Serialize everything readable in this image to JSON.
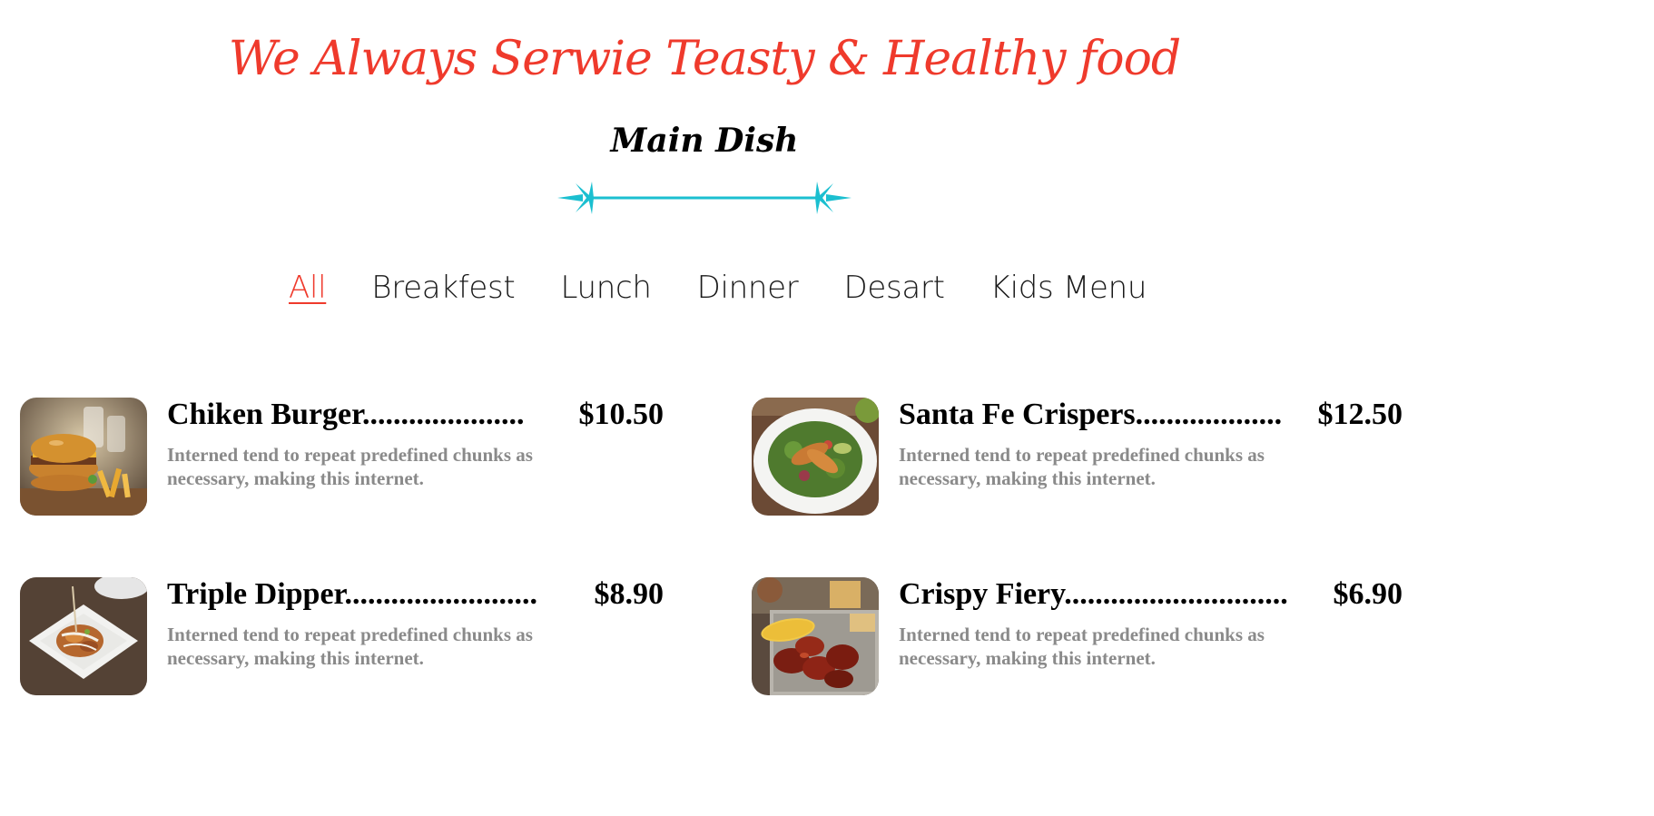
{
  "header": {
    "tagline": "We Always Serwie Teasty & Healthy food",
    "section_title": "Main Dish",
    "accent_color": "#ef3a2c",
    "divider_color": "#1bbfd0"
  },
  "tabs": [
    {
      "label": "All",
      "active": true
    },
    {
      "label": "Breakfest",
      "active": false
    },
    {
      "label": "Lunch",
      "active": false
    },
    {
      "label": "Dinner",
      "active": false
    },
    {
      "label": "Desart",
      "active": false
    },
    {
      "label": "Kids Menu",
      "active": false
    }
  ],
  "menu_items": [
    {
      "name": "Chiken Burger.....................",
      "price": "$10.50",
      "description": "Interned tend to repeat predefined chunks as necessary, making this internet.",
      "image": "burger-with-fries-photo"
    },
    {
      "name": "Santa Fe Crispers...................",
      "price": "$12.50",
      "description": "Interned tend to repeat predefined chunks as necessary, making this internet.",
      "image": "crispy-chicken-salad-photo"
    },
    {
      "name": "Triple Dipper.........................",
      "price": "$8.90",
      "description": "Interned tend to repeat predefined chunks as necessary, making this internet.",
      "image": "chicken-skewers-plate-photo"
    },
    {
      "name": "Crispy Fiery.............................",
      "price": "$6.90",
      "description": "Interned tend to repeat predefined chunks as necessary, making this internet.",
      "image": "fiery-wings-corn-photo"
    }
  ]
}
